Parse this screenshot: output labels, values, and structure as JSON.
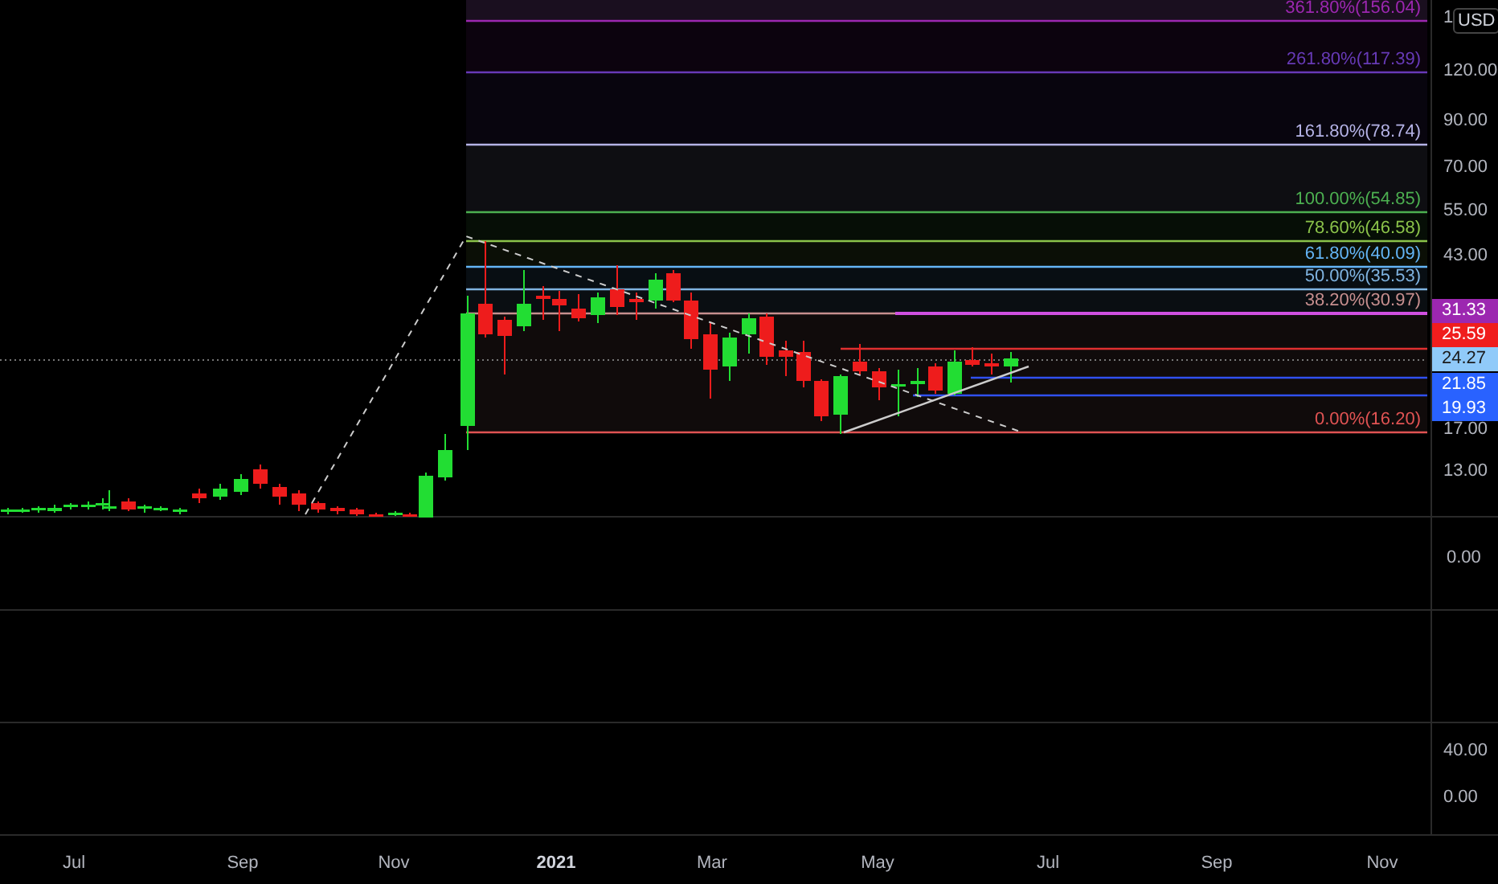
{
  "currency_button": "USD",
  "fib_levels": [
    {
      "label": "361.80%(156.04)",
      "color": "#9c27b0"
    },
    {
      "label": "261.80%(117.39)",
      "color": "#673ab7"
    },
    {
      "label": "161.80%(78.74)",
      "color": "#b5b3e6"
    },
    {
      "label": "100.00%(54.85)",
      "color": "#4caf50"
    },
    {
      "label": "78.60%(46.58)",
      "color": "#8bc34a"
    },
    {
      "label": "61.80%(40.09)",
      "color": "#64b5f6"
    },
    {
      "label": "50.00%(35.53)",
      "color": "#7fb3e0"
    },
    {
      "label": "38.20%(30.97)",
      "color": "#c78f8f"
    },
    {
      "label": "0.00%(16.20)",
      "color": "#e05353"
    }
  ],
  "price_axis": [
    "1",
    "120.00",
    "90.00",
    "70.00",
    "55.00",
    "43.00",
    "17.00",
    "13.00"
  ],
  "price_badges": [
    {
      "label": "31.33",
      "color": "#9c27b0"
    },
    {
      "label": "25.59",
      "color": "#f01d1d"
    },
    {
      "label": "24.27",
      "color": "#90caf9"
    },
    {
      "label": "21.85",
      "color": "#2962ff"
    },
    {
      "label": "19.93",
      "color": "#2962ff"
    }
  ],
  "pane_2_axis": [
    "0.00"
  ],
  "pane_4_axis": [
    "40.00",
    "0.00"
  ],
  "time_axis": [
    "Jul",
    "Sep",
    "Nov",
    "2021",
    "Mar",
    "May",
    "Jul",
    "Sep",
    "Nov"
  ]
}
